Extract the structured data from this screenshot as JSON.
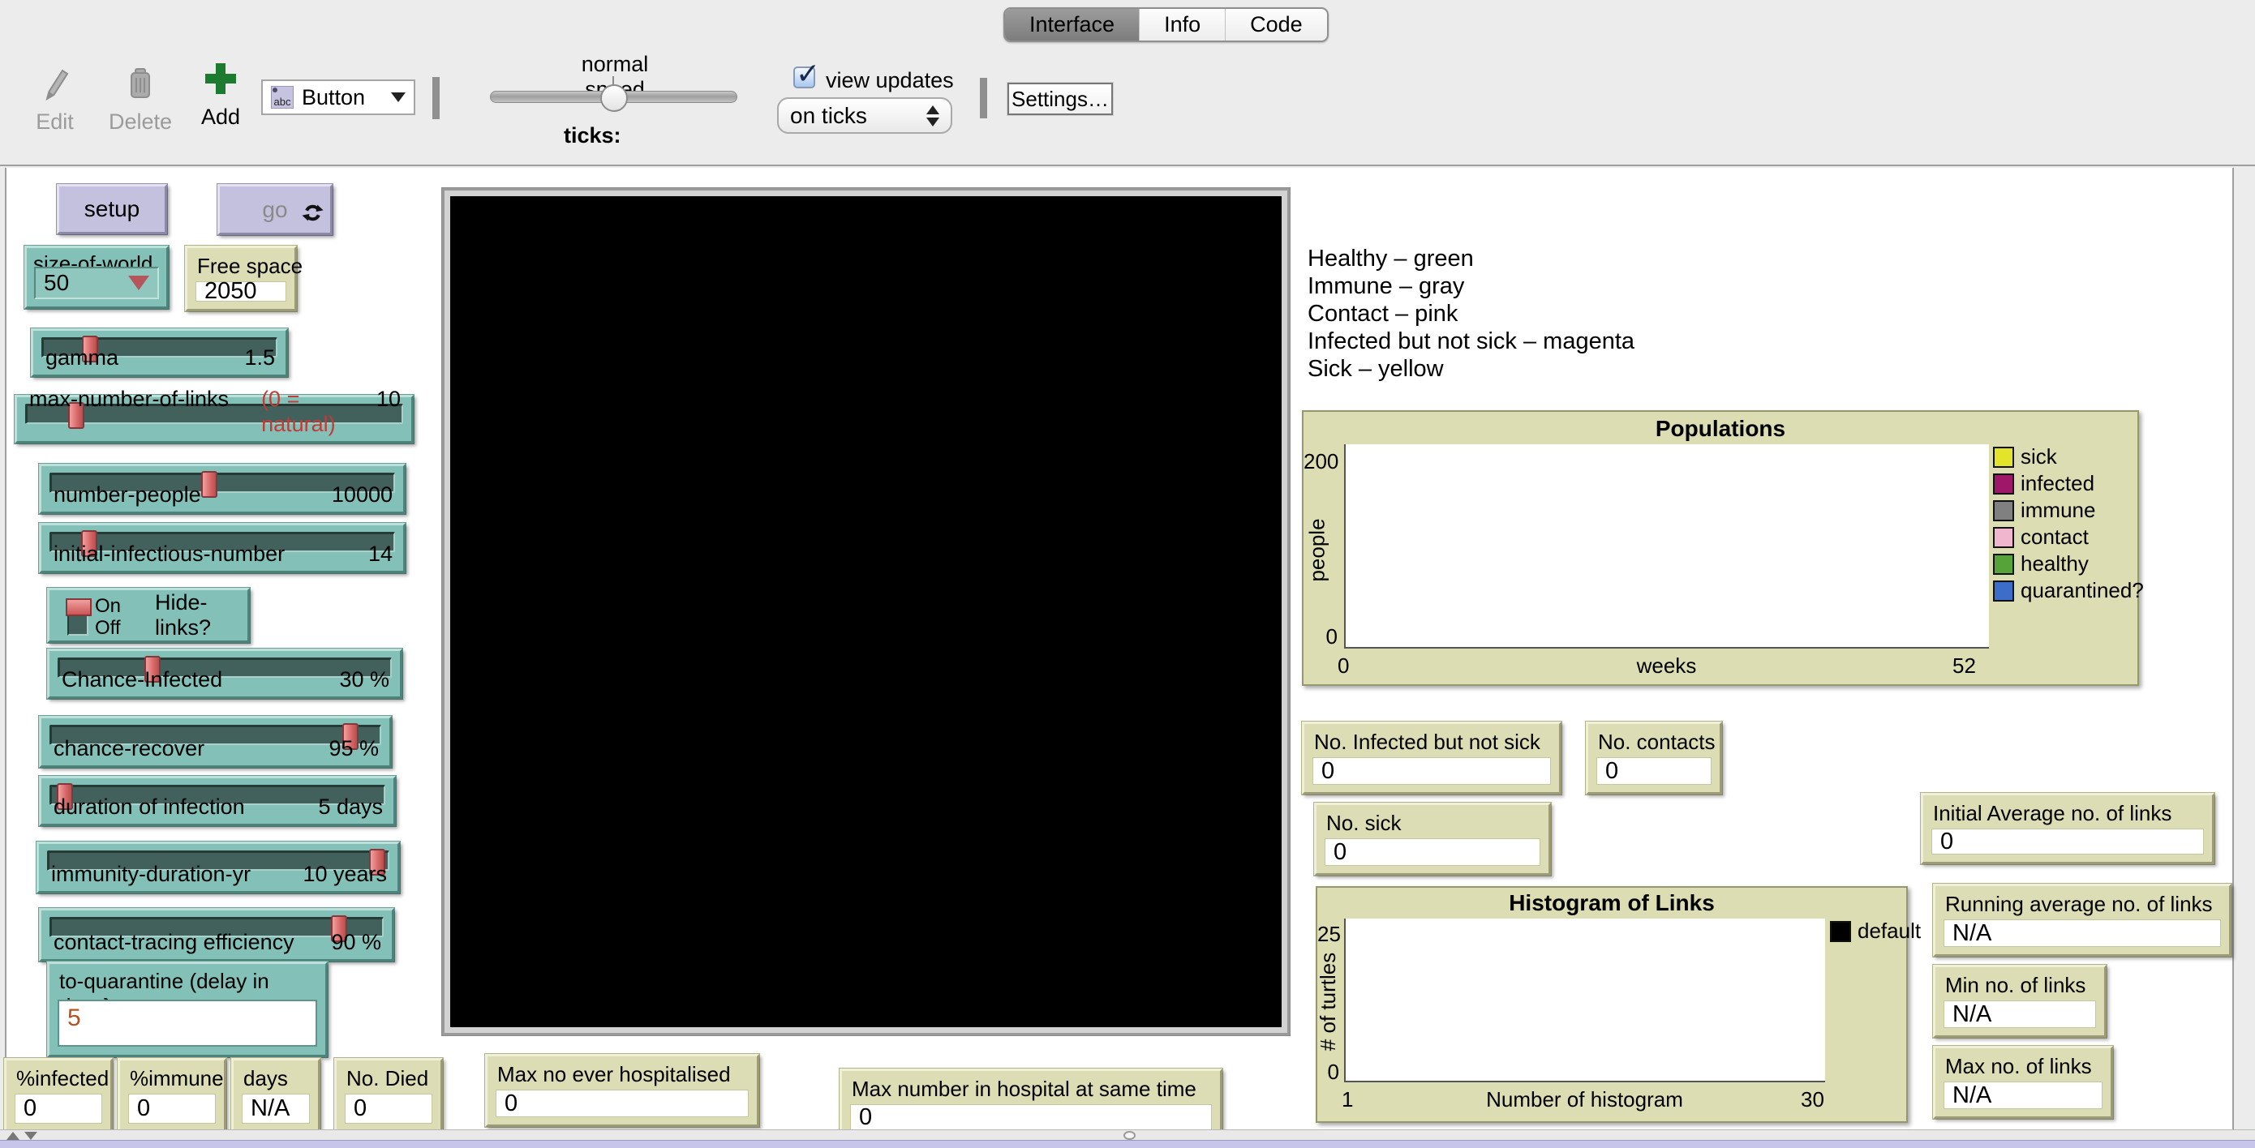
{
  "toolbar": {
    "tabs": [
      "Interface",
      "Info",
      "Code"
    ],
    "selected_tab": "Interface",
    "edit": "Edit",
    "delete": "Delete",
    "add": "Add",
    "widget_dropdown": {
      "value": "Button",
      "icon": "abc"
    },
    "speed": {
      "label": "normal speed",
      "ticks_label": "ticks:"
    },
    "view_updates": {
      "label": "view updates",
      "checked": true
    },
    "update_mode": {
      "value": "on ticks"
    },
    "settings": "Settings…"
  },
  "world_buttons": {
    "setup": "setup",
    "go": {
      "label": "go",
      "forever": true,
      "disabled": true
    }
  },
  "chooser": {
    "label": "size-of-world",
    "value": "50"
  },
  "sliders": {
    "gamma": {
      "label": "gamma",
      "value": "1.5",
      "pct": 20
    },
    "max_links": {
      "label": "max-number-of-links",
      "note": "(0 = natural)",
      "value": "10",
      "pct": 13
    },
    "number_people": {
      "label": "number-people",
      "value": "10000",
      "pct": 46
    },
    "initial_infectious": {
      "label": "initial-infectious-number",
      "value": "14",
      "pct": 11
    },
    "chance_infected": {
      "label": "Chance-Infected",
      "value": "30 %",
      "pct": 28
    },
    "chance_recover": {
      "label": "chance-recover",
      "value": "95 %",
      "pct": 91
    },
    "duration_infection": {
      "label": "duration of infection",
      "value": "5 days",
      "pct": 4
    },
    "immunity_duration": {
      "label": "immunity-duration-yr",
      "value": "10 years",
      "pct": 97
    },
    "contact_tracing": {
      "label": "contact-tracing  efficiency",
      "value": "90 %",
      "pct": 87
    }
  },
  "switch": {
    "on": "On",
    "off": "Off",
    "label": "Hide-links?",
    "state": "On"
  },
  "input_box": {
    "label": "to-quarantine  (delay in days}",
    "value": "5"
  },
  "monitors": {
    "free_space": {
      "label": "Free space",
      "value": "2050"
    },
    "pct_infected": {
      "label": "%infected",
      "value": "0"
    },
    "pct_immune": {
      "label": "%immune",
      "value": "0"
    },
    "days": {
      "label": "days",
      "value": "N/A"
    },
    "no_died": {
      "label": "No. Died",
      "value": "0"
    },
    "max_hospitalised": {
      "label": "Max no ever hospitalised",
      "value": "0"
    },
    "max_in_hospital": {
      "label": "Max number in hospital at same time",
      "value": "0"
    },
    "no_infected_not_sick": {
      "label": "No. Infected but not sick",
      "value": "0"
    },
    "no_contacts": {
      "label": "No. contacts",
      "value": "0"
    },
    "no_sick": {
      "label": "No. sick",
      "value": "0"
    },
    "initial_avg_links": {
      "label": "Initial Average no. of links",
      "value": "0"
    },
    "running_avg_links": {
      "label": "Running average no. of links",
      "value": "N/A"
    },
    "min_links": {
      "label": "Min no. of links",
      "value": "N/A"
    },
    "max_links": {
      "label": "Max no. of links",
      "value": "N/A"
    }
  },
  "legend_text": {
    "lines": [
      "Healthy – green",
      "Immune – gray",
      "Contact – pink",
      "Infected but not sick – magenta",
      "Sick – yellow"
    ]
  },
  "plots": {
    "populations": {
      "title": "Populations",
      "ylabel": "people",
      "y_max": "200",
      "y_min": "0",
      "x_min": "0",
      "xlabel": "weeks",
      "x_max": "52",
      "legend": [
        {
          "label": "sick",
          "color": "#e3e32b"
        },
        {
          "label": "infected",
          "color": "#9e1768"
        },
        {
          "label": "immune",
          "color": "#808080"
        },
        {
          "label": "contact",
          "color": "#efb6cd"
        },
        {
          "label": "healthy",
          "color": "#55a339"
        },
        {
          "label": "quarantined?",
          "color": "#3c6dc9"
        }
      ]
    },
    "histogram": {
      "title": "Histogram of Links",
      "ylabel": "# of turtles",
      "y_max": "25",
      "y_min": "0",
      "x_min": "1",
      "xlabel": "Number of histogram",
      "x_max": "30",
      "legend": [
        {
          "label": "default",
          "color": "#000000"
        }
      ]
    }
  },
  "chart_data": [
    {
      "type": "line",
      "title": "Populations",
      "xlabel": "weeks",
      "ylabel": "people",
      "xlim": [
        0,
        52
      ],
      "ylim": [
        0,
        200
      ],
      "grid": false,
      "legend_position": "right",
      "series": [
        {
          "name": "sick",
          "color": "#e3e32b",
          "x": [],
          "y": []
        },
        {
          "name": "infected",
          "color": "#9e1768",
          "x": [],
          "y": []
        },
        {
          "name": "immune",
          "color": "#808080",
          "x": [],
          "y": []
        },
        {
          "name": "contact",
          "color": "#efb6cd",
          "x": [],
          "y": []
        },
        {
          "name": "healthy",
          "color": "#55a339",
          "x": [],
          "y": []
        },
        {
          "name": "quarantined?",
          "color": "#3c6dc9",
          "x": [],
          "y": []
        }
      ],
      "note": "plot area is empty - model not yet run"
    },
    {
      "type": "bar",
      "title": "Histogram of Links",
      "xlabel": "Number of histogram",
      "ylabel": "# of turtles",
      "xlim": [
        1,
        30
      ],
      "ylim": [
        0,
        25
      ],
      "grid": false,
      "legend_position": "right",
      "series": [
        {
          "name": "default",
          "color": "#000000",
          "x": [],
          "y": []
        }
      ],
      "note": "plot area is empty - model not yet run"
    }
  ],
  "colors": {
    "widget_teal": "#83c0b8",
    "widget_button": "#c4c1df",
    "monitor_bg": "#dcddb4",
    "plot_bg": "#dcddb2",
    "slider_thumb": "#d96a6a",
    "toolbar_bg": "#ececec",
    "bottom_strip": "#c7c5ea",
    "input_value": "#b4531f"
  }
}
